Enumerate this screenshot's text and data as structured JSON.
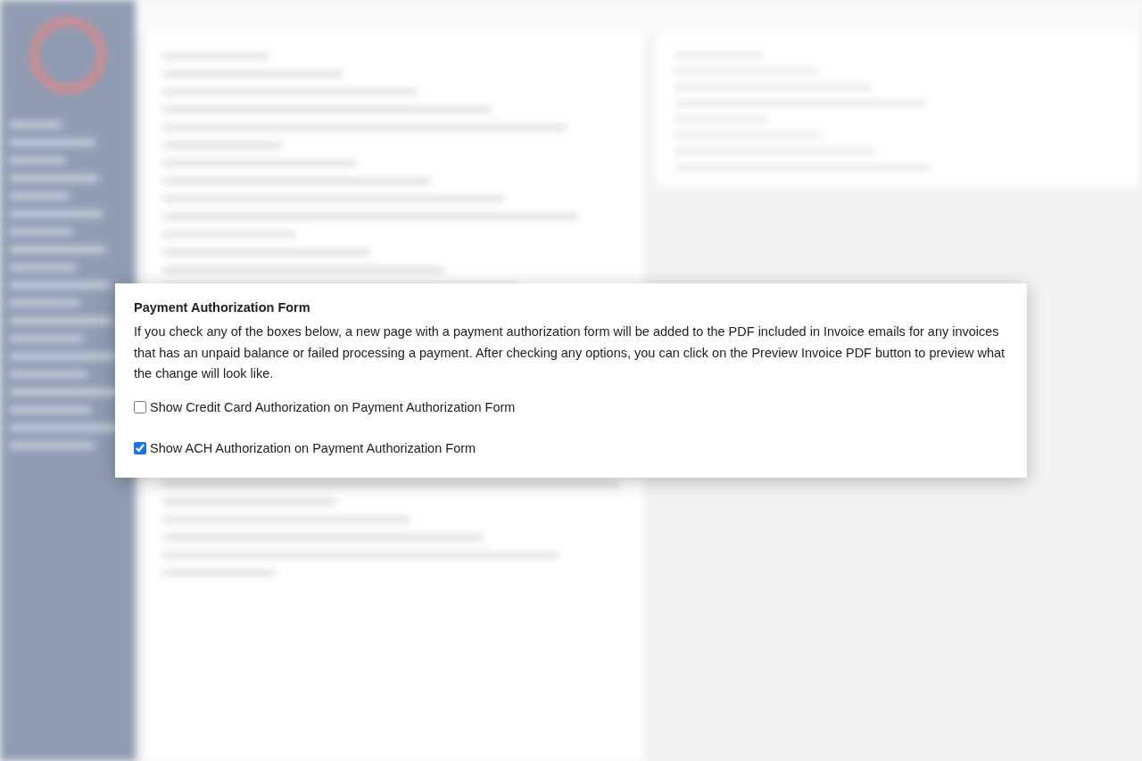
{
  "dialog": {
    "title": "Payment Authorization Form",
    "description": "If you check any of the boxes below, a new page with a payment authorization form will be added to the PDF included in Invoice emails for any invoices that has an unpaid balance or failed processing a payment. After checking any options, you can click on the Preview Invoice PDF button to preview what the change will look like.",
    "options": [
      {
        "label": "Show Credit Card Authorization on Payment Authorization Form",
        "checked": false
      },
      {
        "label": "Show ACH Authorization on Payment Authorization Form",
        "checked": true
      }
    ]
  }
}
